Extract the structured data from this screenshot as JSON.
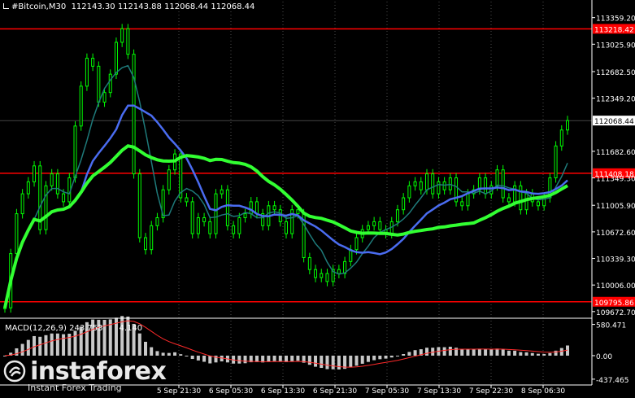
{
  "header": {
    "symbol_timeframe": "#Bitcoin,M30",
    "ohlc": "112143.30 112143.88 112068.44 112068.44"
  },
  "price_axis": {
    "ticks": [
      "113359.20",
      "113025.90",
      "112682.50",
      "112349.20",
      "111682.60",
      "111349.30",
      "111005.90",
      "110672.60",
      "110339.30",
      "110006.00",
      "109672.70"
    ],
    "hlines": [
      {
        "value": 113218.42,
        "label": "113218.42"
      },
      {
        "value": 111408.18,
        "label": "111408.18"
      },
      {
        "value": 109795.86,
        "label": "109795.86"
      }
    ],
    "current": {
      "value": 112068.44,
      "label": "112068.44"
    },
    "ylim": [
      109620,
      113560
    ]
  },
  "time_axis": {
    "labels": [
      "5 Sep 21:30",
      "6 Sep 05:30",
      "6 Sep 13:30",
      "6 Sep 21:30",
      "7 Sep 05:30",
      "7 Sep 13:30",
      "7 Sep 22:30",
      "8 Sep 06:30"
    ]
  },
  "macd": {
    "label": "MACD(12,26,9) 243.753",
    "label_tail": "4.140",
    "axis_ticks": [
      "580.471",
      "0.00",
      "-437.465"
    ],
    "ylim": [
      -500,
      650
    ]
  },
  "watermark": {
    "brand": "instaforex",
    "tagline": "Instant Forex Trading"
  },
  "colors": {
    "background": "#000000",
    "candle": "#00ff00",
    "hline": "#ff0000",
    "ma_fast": "#1e7a7a",
    "ma_mid": "#4a6cf0",
    "ma_slow": "#32ff32",
    "macd_hist": "#c8c8c8",
    "macd_signal": "#ff2a2a",
    "axis_text": "#ffffff",
    "grid": "#4d4d4d"
  },
  "chart_data": {
    "type": "line",
    "series": [
      {
        "name": "#Bitcoin,M30",
        "values": [
          109720,
          110400,
          110900,
          111150,
          111300,
          111500,
          110700,
          111250,
          111400,
          111150,
          111050,
          111350,
          112000,
          112500,
          112850,
          112750,
          112300,
          112420,
          112650,
          113050,
          113220,
          112900,
          111400,
          110600,
          110450,
          110750,
          110850,
          111200,
          111450,
          111650,
          111100,
          111050,
          110650,
          110850,
          110800,
          110650,
          111150,
          111200,
          110750,
          110650,
          110850,
          110900,
          111050,
          110900,
          110750,
          111000,
          110950,
          110800,
          110650,
          110950,
          110900,
          110350,
          110200,
          110100,
          110150,
          110050,
          110200,
          110150,
          110300,
          110450,
          110600,
          110700,
          110750,
          110800,
          110700,
          110650,
          110800,
          110950,
          111100,
          111250,
          111300,
          111200,
          111400,
          111150,
          111300,
          111200,
          111350,
          111050,
          111000,
          111150,
          111200,
          111350,
          111150,
          111250,
          111450,
          111100,
          111050,
          111250,
          110950,
          111150,
          111050,
          111000,
          111100,
          111350,
          111750,
          111950,
          112068
        ]
      }
    ]
  }
}
